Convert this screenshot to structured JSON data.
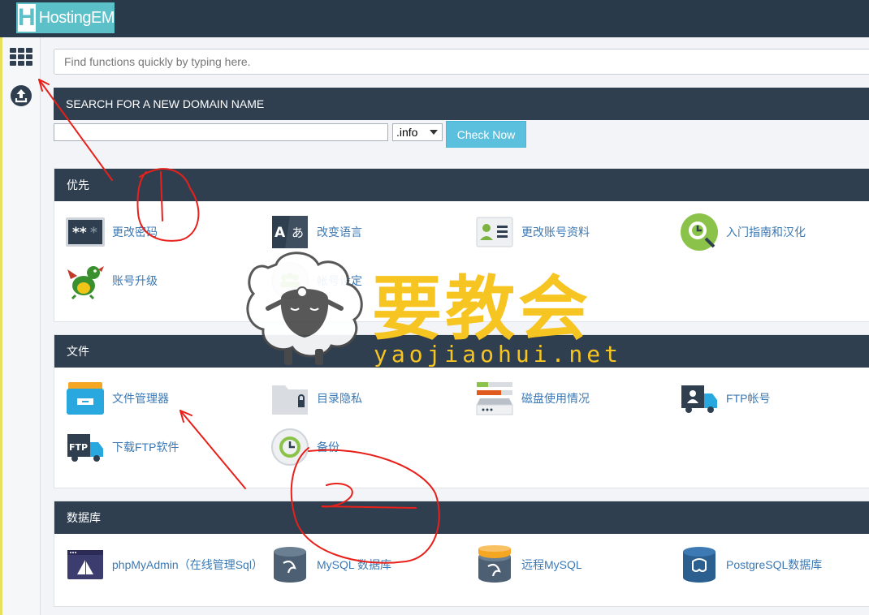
{
  "header": {
    "logo_letter": "H",
    "logo_text": "HostingEM"
  },
  "sidebar": {
    "icons": [
      "apps-grid-icon",
      "upload-icon"
    ]
  },
  "search": {
    "placeholder": "Find functions quickly by typing here."
  },
  "domain": {
    "title": "SEARCH FOR A NEW DOMAIN NAME",
    "input_value": "",
    "tld_selected": ".info",
    "check_label": "Check Now"
  },
  "sections": {
    "priority": {
      "title": "优先",
      "items": [
        {
          "label": "更改密码",
          "icon": "password-icon"
        },
        {
          "label": "改变语言",
          "icon": "language-icon"
        },
        {
          "label": "更改账号资料",
          "icon": "contact-card-icon"
        },
        {
          "label": "入门指南和汉化",
          "icon": "getting-started-icon"
        },
        {
          "label": "账号升级",
          "icon": "dragon-icon"
        },
        {
          "label": "帐号设定",
          "icon": "account-settings-icon"
        }
      ]
    },
    "files": {
      "title": "文件",
      "items": [
        {
          "label": "文件管理器",
          "icon": "file-manager-icon"
        },
        {
          "label": "目录隐私",
          "icon": "folder-lock-icon"
        },
        {
          "label": "磁盘使用情况",
          "icon": "disk-usage-icon"
        },
        {
          "label": "FTP帐号",
          "icon": "ftp-account-icon"
        },
        {
          "label": "下载FTP软件",
          "icon": "ftp-truck-icon"
        },
        {
          "label": "备份",
          "icon": "backup-icon"
        }
      ]
    },
    "databases": {
      "title": "数据库",
      "items": [
        {
          "label": "phpMyAdmin（在线管理Sql）",
          "icon": "phpmyadmin-icon"
        },
        {
          "label": "MySQL 数据库",
          "icon": "mysql-database-icon"
        },
        {
          "label": "远程MySQL",
          "icon": "remote-mysql-icon"
        },
        {
          "label": "PostgreSQL数据库",
          "icon": "postgresql-icon"
        }
      ]
    }
  },
  "watermark": {
    "cn": "要教会",
    "en": "yaojiaohui.net"
  },
  "colors": {
    "topbar": "#293a4a",
    "panel_head": "#2f3f50",
    "link": "#3b79b4",
    "accent": "#5bc0de",
    "annotation": "#e8201a",
    "watermark": "#f7c521"
  }
}
